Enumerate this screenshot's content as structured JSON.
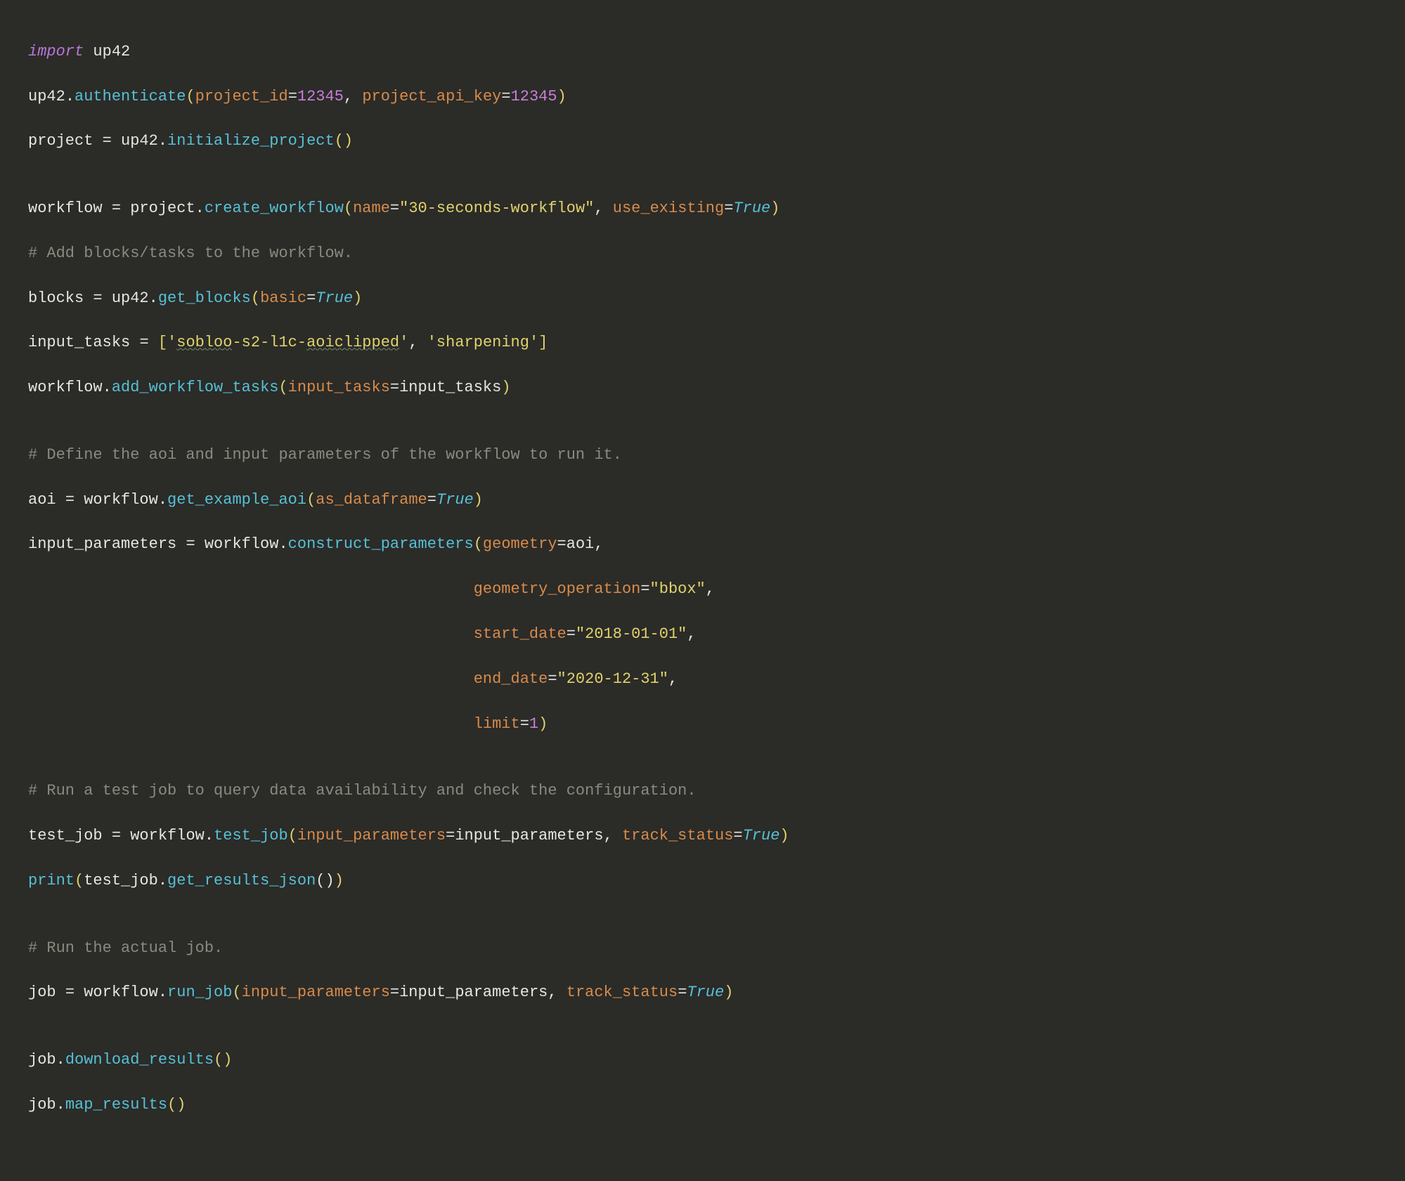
{
  "code": {
    "l01": {
      "kw_import": "import",
      "sp": " ",
      "mod": "up42"
    },
    "l02": {
      "obj": "up42",
      "dot": ".",
      "fn": "authenticate",
      "lp": "(",
      "p1": "project_id",
      "eq1": "=",
      "n1": "12345",
      "c1": ", ",
      "p2": "project_api_key",
      "eq2": "=",
      "n2": "12345",
      "rp": ")"
    },
    "l03": {
      "v": "project ",
      "eq": "= ",
      "obj": "up42",
      "dot": ".",
      "fn": "initialize_project",
      "lp": "(",
      "rp": ")"
    },
    "l04": "",
    "l05": {
      "v": "workflow ",
      "eq": "= ",
      "obj": "project",
      "dot": ".",
      "fn": "create_workflow",
      "lp": "(",
      "p1": "name",
      "eq1": "=",
      "s1": "\"30-seconds-workflow\"",
      "c1": ", ",
      "p2": "use_existing",
      "eq2": "=",
      "const": "True",
      "rp": ")"
    },
    "l06": {
      "comment": "# Add blocks/tasks to the workflow."
    },
    "l07": {
      "v": "blocks ",
      "eq": "= ",
      "obj": "up42",
      "dot": ".",
      "fn": "get_blocks",
      "lp": "(",
      "p1": "basic",
      "eq1": "=",
      "const": "True",
      "rp": ")"
    },
    "l08": {
      "v": "input_tasks ",
      "eq": "= ",
      "lb": "[",
      "q1a": "'",
      "s1": "sobloo",
      "s1b": "-s2-l1c-",
      "s1c": "aoiclipped",
      "q1b": "'",
      "c1": ", ",
      "s2": "'sharpening'",
      "rb": "]"
    },
    "l09": {
      "obj": "workflow",
      "dot": ".",
      "fn": "add_workflow_tasks",
      "lp": "(",
      "p1": "input_tasks",
      "eq1": "=",
      "a1": "input_tasks",
      "rp": ")"
    },
    "l10": "",
    "l11": {
      "comment": "# Define the aoi and input parameters of the workflow to run it."
    },
    "l12": {
      "v": "aoi ",
      "eq": "= ",
      "obj": "workflow",
      "dot": ".",
      "fn": "get_example_aoi",
      "lp": "(",
      "p1": "as_dataframe",
      "eq1": "=",
      "const": "True",
      "rp": ")"
    },
    "l13": {
      "v": "input_parameters ",
      "eq": "= ",
      "obj": "workflow",
      "dot": ".",
      "fn": "construct_parameters",
      "lp": "(",
      "p1": "geometry",
      "eq1": "=",
      "a1": "aoi",
      "c1": ","
    },
    "l14": {
      "indent": "                                                ",
      "p1": "geometry_operation",
      "eq1": "=",
      "s1": "\"bbox\"",
      "c1": ","
    },
    "l15": {
      "indent": "                                                ",
      "p1": "start_date",
      "eq1": "=",
      "s1": "\"2018-01-01\"",
      "c1": ","
    },
    "l16": {
      "indent": "                                                ",
      "p1": "end_date",
      "eq1": "=",
      "s1": "\"2020-12-31\"",
      "c1": ","
    },
    "l17": {
      "indent": "                                                ",
      "p1": "limit",
      "eq1": "=",
      "n1": "1",
      "rp": ")"
    },
    "l18": "",
    "l19": {
      "comment": "# Run a test job to query data availability and check the configuration."
    },
    "l20": {
      "v": "test_job ",
      "eq": "= ",
      "obj": "workflow",
      "dot": ".",
      "fn": "test_job",
      "lp": "(",
      "p1": "input_parameters",
      "eq1": "=",
      "a1": "input_parameters",
      "c1": ", ",
      "p2": "track_status",
      "eq2": "=",
      "const": "True",
      "rp": ")"
    },
    "l21": {
      "fn0": "print",
      "lp0": "(",
      "obj": "test_job",
      "dot": ".",
      "fn": "get_results_json",
      "lp": "(",
      "rp": ")",
      "rp0": ")"
    },
    "l22": "",
    "l23": {
      "comment": "# Run the actual job."
    },
    "l24": {
      "v": "job ",
      "eq": "= ",
      "obj": "workflow",
      "dot": ".",
      "fn": "run_job",
      "lp": "(",
      "p1": "input_parameters",
      "eq1": "=",
      "a1": "input_parameters",
      "c1": ", ",
      "p2": "track_status",
      "eq2": "=",
      "const": "True",
      "rp": ")"
    },
    "l25": "",
    "l26": {
      "obj": "job",
      "dot": ".",
      "fn": "download_results",
      "lp": "(",
      "rp": ")"
    },
    "l27": {
      "obj": "job",
      "dot": ".",
      "fn": "map_results",
      "lp": "(",
      "rp": ")"
    }
  }
}
